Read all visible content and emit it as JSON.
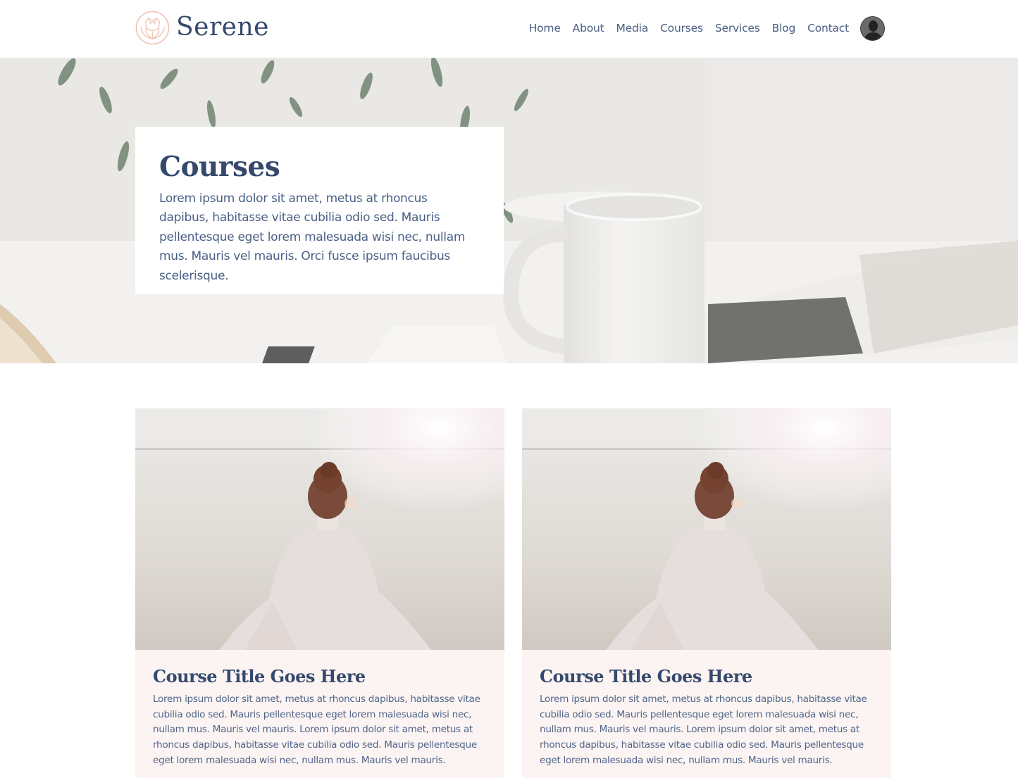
{
  "brand": {
    "name": "Serene",
    "logo_icon": "lotus-icon",
    "accent_color": "#f0c4b4",
    "text_color": "#34496c"
  },
  "nav": {
    "items": [
      {
        "label": "Home"
      },
      {
        "label": "About"
      },
      {
        "label": "Media"
      },
      {
        "label": "Courses"
      },
      {
        "label": "Services"
      },
      {
        "label": "Blog"
      },
      {
        "label": "Contact"
      }
    ],
    "avatar_icon": "user-avatar-icon"
  },
  "hero": {
    "title": "Courses",
    "text": "Lorem ipsum dolor sit amet, metus at rhoncus dapibus, habitasse vitae cubilia odio sed. Mauris pellentesque eget lorem malesuada wisi nec, nullam mus. Mauris vel mauris. Orci fusce ipsum faucibus scelerisque.",
    "image": "desk-with-mug-and-newspaper"
  },
  "courses": [
    {
      "title": "Course Title Goes Here",
      "text": "Lorem ipsum dolor sit amet, metus at rhoncus dapibus, habitasse vitae cubilia odio sed. Mauris pellentesque eget lorem malesuada wisi nec, nullam mus. Mauris vel mauris. Lorem ipsum dolor sit amet, metus at rhoncus dapibus, habitasse vitae cubilia odio sed. Mauris pellentesque eget lorem malesuada wisi nec, nullam mus. Mauris vel mauris.",
      "image": "woman-on-beach"
    },
    {
      "title": "Course Title Goes Here",
      "text": "Lorem ipsum dolor sit amet, metus at rhoncus dapibus, habitasse vitae cubilia odio sed. Mauris pellentesque eget lorem malesuada wisi nec, nullam mus. Mauris vel mauris. Lorem ipsum dolor sit amet, metus at rhoncus dapibus, habitasse vitae cubilia odio sed. Mauris pellentesque eget lorem malesuada wisi nec, nullam mus. Mauris vel mauris.",
      "image": "woman-on-beach"
    }
  ]
}
